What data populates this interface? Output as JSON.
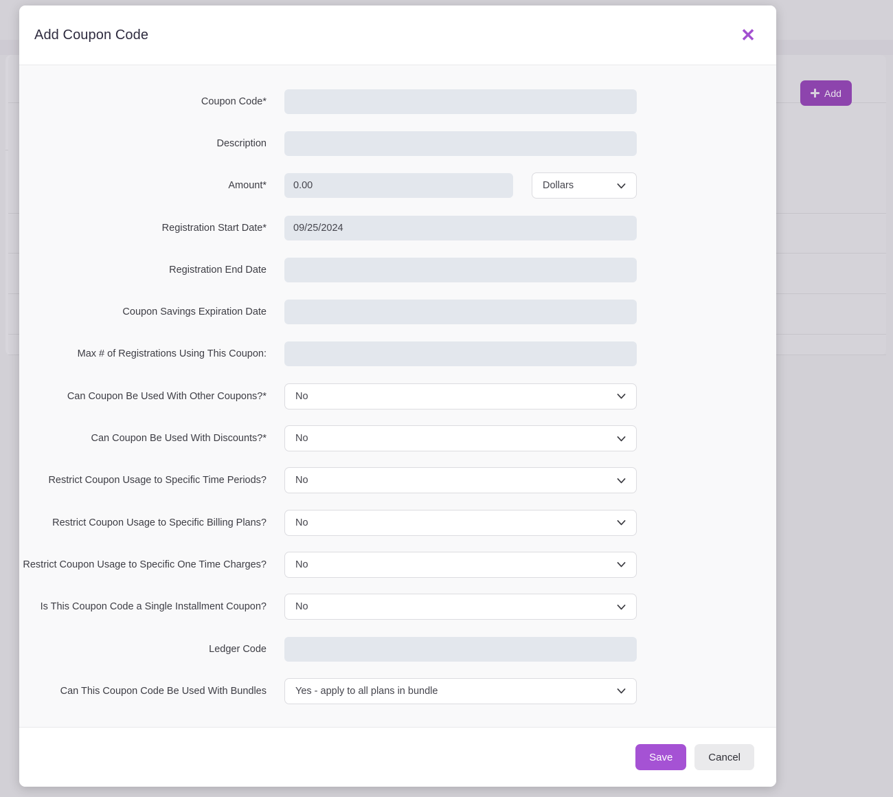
{
  "background": {
    "add_button": {
      "label": "Add",
      "icon": "plus-icon",
      "color": "#8d44ad"
    },
    "row_buttons": [
      "",
      "",
      ""
    ]
  },
  "modal": {
    "title": "Add Coupon Code",
    "close_icon": "close-icon",
    "accent_color": "#a552d4",
    "fields": [
      {
        "label": "Coupon Code*",
        "type": "input",
        "value": "",
        "control": "text"
      },
      {
        "label": "Description",
        "type": "input",
        "value": "",
        "control": "text"
      },
      {
        "label": "Amount*",
        "type": "input-select",
        "value": "0.00",
        "select_value": "Dollars"
      },
      {
        "label": "Registration Start Date*",
        "type": "input",
        "value": "09/25/2024",
        "control": "date"
      },
      {
        "label": "Registration End Date",
        "type": "input",
        "value": "",
        "control": "date"
      },
      {
        "label": "Coupon Savings Expiration Date",
        "type": "input",
        "value": "",
        "control": "date"
      },
      {
        "label": "Max # of Registrations Using This Coupon:",
        "type": "input",
        "value": "",
        "control": "number"
      },
      {
        "label": "Can Coupon Be Used With Other Coupons?*",
        "type": "select",
        "value": "No"
      },
      {
        "label": "Can Coupon Be Used With Discounts?*",
        "type": "select",
        "value": "No"
      },
      {
        "label": "Restrict Coupon Usage to Specific Time Periods?",
        "type": "select",
        "value": "No"
      },
      {
        "label": "Restrict Coupon Usage to Specific Billing Plans?",
        "type": "select",
        "value": "No"
      },
      {
        "label": "Restrict Coupon Usage to Specific One Time Charges?",
        "type": "select",
        "value": "No"
      },
      {
        "label": "Is This Coupon Code a Single Installment Coupon?",
        "type": "select",
        "value": "No"
      },
      {
        "label": "Ledger Code",
        "type": "input",
        "value": "",
        "control": "text"
      },
      {
        "label": "Can This Coupon Code Be Used With Bundles",
        "type": "select",
        "value": "Yes - apply to all plans in bundle"
      }
    ],
    "footer": {
      "save_label": "Save",
      "cancel_label": "Cancel"
    }
  }
}
